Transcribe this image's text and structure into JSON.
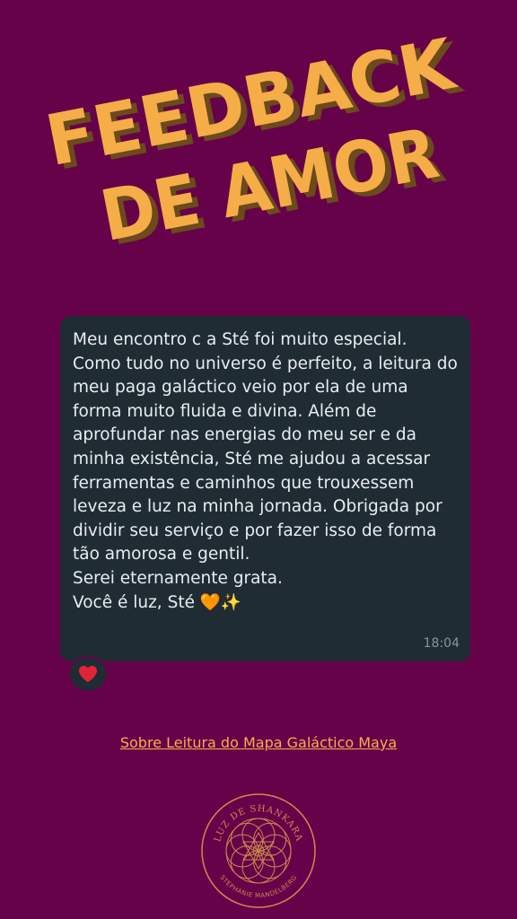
{
  "title": {
    "line1": "FEEDBACK",
    "line2": "DE AMOR"
  },
  "message": {
    "text": "Meu encontro c a Sté foi muito especial. Como tudo no universo é perfeito, a leitura do meu paga galáctico veio por ela de uma forma muito fluida e divina. Além de aprofundar nas energias do meu ser e da minha existência, Sté me ajudou a acessar ferramentas e caminhos que trouxessem leveza e luz na minha jornada. Obrigada por dividir seu serviço e por fazer isso de forma tão amorosa e gentil.\nSerei eternamente grata.\nVocê é luz, Sté 🧡✨",
    "time": "18:04"
  },
  "reaction": {
    "icon": "heart-icon",
    "emoji": "❤️"
  },
  "link": {
    "label": "Sobre Leitura do Mapa Galáctico Maya"
  },
  "logo": {
    "top_text": "LUZ DE SHANKARA",
    "bottom_text": "STEPHANIE MANDELBERG"
  },
  "colors": {
    "background": "#66024a",
    "title_fill": "#f5ad47",
    "title_shadow": "#6b4a1c",
    "bubble": "#1f2c34",
    "link": "#f4b04a",
    "logo_stroke": "#c98a4b"
  }
}
